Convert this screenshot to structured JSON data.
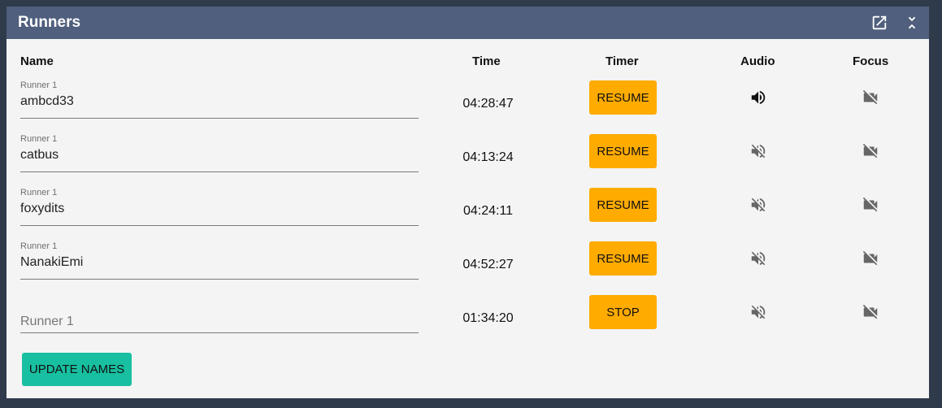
{
  "panel": {
    "title": "Runners",
    "header_icons": [
      "open-in-new-icon",
      "collapse-icon"
    ]
  },
  "columns": {
    "name": "Name",
    "time": "Time",
    "timer": "Timer",
    "audio": "Audio",
    "focus": "Focus"
  },
  "runners": [
    {
      "label": "Runner 1",
      "name": "ambcd33",
      "placeholder": "",
      "time": "04:28:47",
      "button": "RESUME",
      "audio": "volume-up-icon",
      "focus": "videocam-off-icon"
    },
    {
      "label": "Runner 1",
      "name": "catbus",
      "placeholder": "",
      "time": "04:13:24",
      "button": "RESUME",
      "audio": "volume-off-icon",
      "focus": "videocam-off-icon"
    },
    {
      "label": "Runner 1",
      "name": "foxydits",
      "placeholder": "",
      "time": "04:24:11",
      "button": "RESUME",
      "audio": "volume-off-icon",
      "focus": "videocam-off-icon"
    },
    {
      "label": "Runner 1",
      "name": "NanakiEmi",
      "placeholder": "",
      "time": "04:52:27",
      "button": "RESUME",
      "audio": "volume-off-icon",
      "focus": "videocam-off-icon"
    },
    {
      "label": "",
      "name": "",
      "placeholder": "Runner 1",
      "time": "01:34:20",
      "button": "STOP",
      "audio": "volume-off-icon",
      "focus": "videocam-off-icon"
    }
  ],
  "actions": {
    "update_names": "UPDATE NAMES"
  },
  "colors": {
    "header_bg": "#4f5f7d",
    "panel_bg": "#f4f4f4",
    "page_bg": "#2f3a4b",
    "timer_button": "#ffab00",
    "update_button": "#18bfa0",
    "icon_active": "#111111",
    "icon_muted": "#666666"
  }
}
